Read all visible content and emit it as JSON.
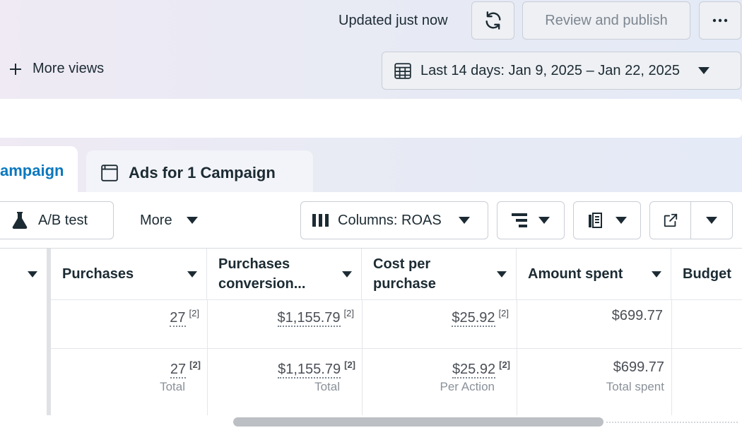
{
  "header": {
    "updated_text": "Updated just now",
    "publish_label": "Review and publish"
  },
  "views": {
    "more_views_label": "More views"
  },
  "date_range": {
    "label": "Last 14 days: Jan 9, 2025 – Jan 22, 2025"
  },
  "tabs": {
    "active_partial": "ampaign",
    "ads_label": "Ads for 1 Campaign"
  },
  "toolbar": {
    "ab_test_label": "A/B test",
    "more_label": "More",
    "columns_label": "Columns: ROAS"
  },
  "table": {
    "columns": [
      "Purchases",
      "Purchases conversion...",
      "Cost per purchase",
      "Amount spent",
      "Budget"
    ],
    "rows": [
      {
        "purchases": "27",
        "purchases_ref": "[2]",
        "conversion_value": "$1,155.79",
        "conversion_ref": "[2]",
        "cost_per_purchase": "$25.92",
        "cost_ref": "[2]",
        "amount_spent": "$699.77"
      }
    ],
    "totals": {
      "purchases": "27",
      "purchases_ref": "[2]",
      "purchases_sub": "Total",
      "conversion_value": "$1,155.79",
      "conversion_ref": "[2]",
      "conversion_sub": "Total",
      "cost_per_purchase": "$25.92",
      "cost_ref": "[2]",
      "cost_sub": "Per Action",
      "amount_spent": "$699.77",
      "amount_sub": "Total spent"
    }
  },
  "colors": {
    "accent_blue": "#0a78be",
    "text_dark": "#1c2b33",
    "muted": "#8a9199"
  }
}
